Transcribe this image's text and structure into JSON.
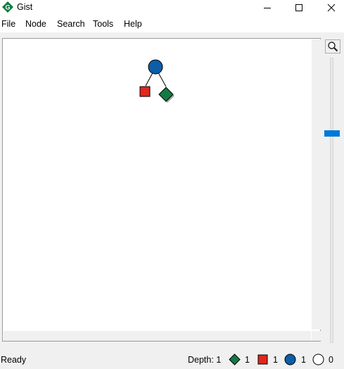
{
  "window": {
    "title": "Gist",
    "icon": "gist-logo-icon",
    "controls": [
      "minimize-icon",
      "maximize-icon",
      "close-icon"
    ]
  },
  "menu": {
    "items": [
      {
        "label": "File"
      },
      {
        "label": "Node"
      },
      {
        "label": "Search"
      },
      {
        "label": "Tools"
      },
      {
        "label": "Help"
      }
    ]
  },
  "tree": {
    "root": {
      "shape": "circle",
      "color": "#0b5ea8"
    },
    "children": [
      {
        "shape": "square",
        "color": "#e0281c"
      },
      {
        "shape": "diamond",
        "color": "#137a43"
      }
    ]
  },
  "zoom": {
    "icon": "magnifier-icon",
    "level": 0.75
  },
  "status": {
    "text": "Ready",
    "depth_label": "Depth:",
    "depth_value": "1",
    "legend": [
      {
        "icon": "solved-diamond-icon",
        "color": "#137a43",
        "count": "1"
      },
      {
        "icon": "failed-square-icon",
        "color": "#e0281c",
        "count": "1"
      },
      {
        "icon": "choice-circle-icon",
        "color": "#0b5ea8",
        "count": "1"
      },
      {
        "icon": "open-circle-icon",
        "color": "#ffffff",
        "count": "0"
      }
    ]
  }
}
